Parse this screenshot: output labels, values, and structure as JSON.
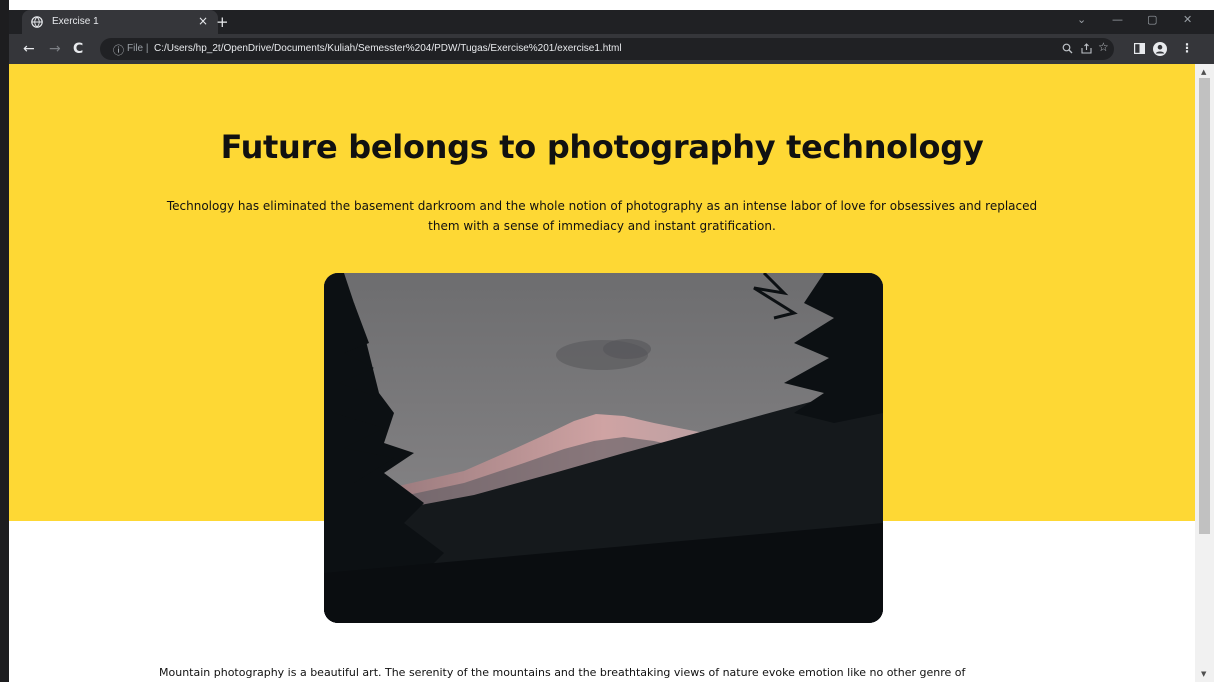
{
  "browser": {
    "tab_title": "Exercise 1",
    "tab_close": "×",
    "new_tab": "+",
    "scheme_label": "File",
    "url": "C:/Users/hp_2t/OpenDrive/Documents/Kuliah/Semesster%204/PDW/Tugas/Exercise%201/exercise1.html",
    "icons": [
      "globe-icon",
      "back-icon",
      "forward-icon",
      "reload-icon",
      "info-icon",
      "zoom-icon",
      "share-icon",
      "star-icon",
      "sidepanel-icon",
      "profile-icon",
      "menu-icon"
    ]
  },
  "page": {
    "headline": "Future belongs to photography technology",
    "lead": "Technology has eliminated the basement darkroom and the whole notion of photography as an intense labor of love for obsessives and replaced them with a sense of immediacy and instant gratification.",
    "body": "Mountain photography is a beautiful art. The serenity of the mountains and the breathtaking views of nature evoke emotion like no other genre of",
    "colors": {
      "hero": "#fed834",
      "text": "#111111",
      "background": "#ffffff"
    }
  }
}
